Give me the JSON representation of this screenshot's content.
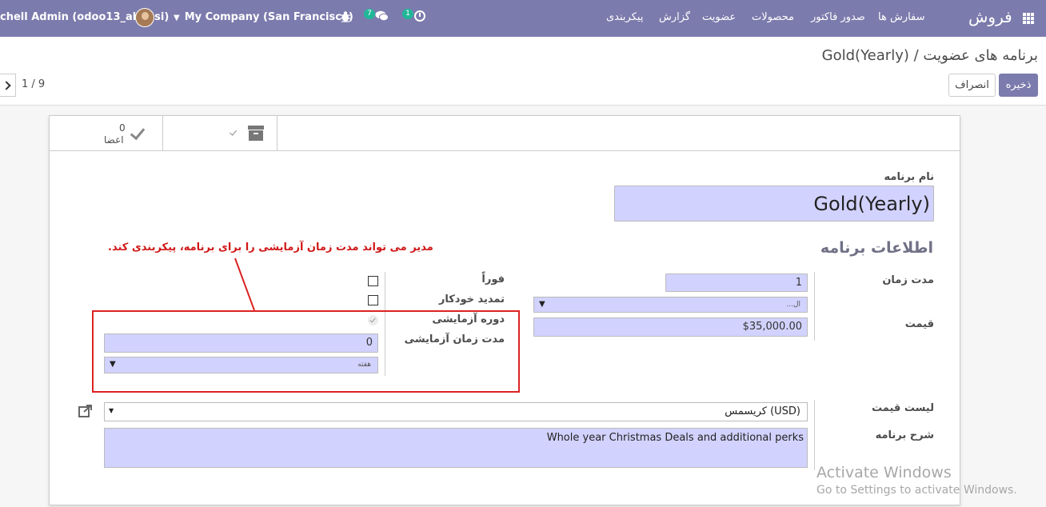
{
  "navbar": {
    "user": "chell Admin (odoo13_abbasi)",
    "company": "My Company (San Francisco)",
    "messages_count": "7",
    "activities_count": "1",
    "brand": "فروش",
    "menu": [
      "سفارش ها",
      "صدور فاکتور",
      "محصولات",
      "عضویت",
      "گزارش",
      "پیکربندی"
    ]
  },
  "breadcrumb": {
    "parent": "برنامه های عضویت",
    "separator": "/",
    "current": "Gold(Yearly)"
  },
  "buttons": {
    "save": "ذخیره",
    "discard": "انصراف"
  },
  "pager": "1 / 9",
  "stat_buttons": {
    "members_value": "0",
    "members_label": "اعضا"
  },
  "form": {
    "name_label": "نام برنامه",
    "name_value": "Gold(Yearly)",
    "section_title": "اطلاعات برنامه",
    "duration_label": "مدت زمان",
    "duration_value": "1",
    "duration_unit_value": "...ال",
    "price_label": "قیمت",
    "price_value": "$35,000.00",
    "immediate_label": "فوراً",
    "auto_renew_label": "تمدید خودکار",
    "trial_label": "دوره آزمایشی",
    "trial_duration_label": "مدت زمان آزمایشی",
    "trial_duration_value": "0",
    "trial_unit_value": "هفته",
    "pricelist_label": "لیست قیمت",
    "pricelist_value": "کریسمس (USD)",
    "description_label": "شرح برنامه",
    "description_value": "Whole year Christmas Deals and additional perks"
  },
  "annotation": {
    "text": "مدیر می تواند مدت زمان آزمایشی را برای برنامه، پیکربندی کند.",
    "color": "#d01818"
  },
  "watermark": {
    "line1": "Activate Windows",
    "line2": "Go to Settings to activate Windows."
  },
  "colors": {
    "navbar": "#7c7bad",
    "input_bg": "#d2d2ff",
    "badge": "#21b799"
  }
}
